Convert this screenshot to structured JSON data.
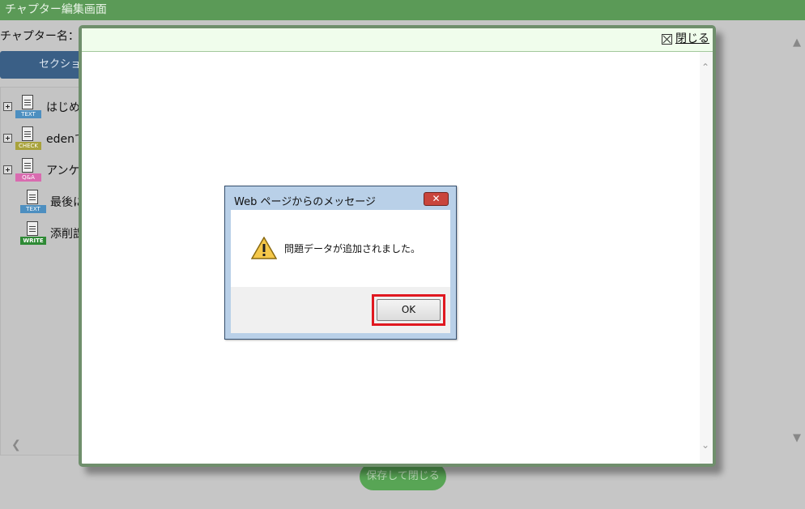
{
  "window": {
    "title": "チャプター編集画面"
  },
  "page": {
    "chapter_label": "チャプター名：",
    "section_button": "セクション",
    "save_button": "保存して閉じる"
  },
  "tree": {
    "items": [
      {
        "text": "はじめ",
        "icon": "text-doc-icon",
        "tag": "TEXT",
        "tag_color": "#4d8fc0",
        "expandable": true
      },
      {
        "text": "edenで",
        "icon": "check-doc-icon",
        "tag": "CHECK",
        "tag_color": "#a8a23c",
        "expandable": true
      },
      {
        "text": "アンケ",
        "icon": "qa-doc-icon",
        "tag": "Q&A",
        "tag_color": "#d96bb0",
        "expandable": true
      },
      {
        "text": "最後に",
        "icon": "text-doc-icon",
        "tag": "TEXT",
        "tag_color": "#4d8fc0",
        "expandable": false
      },
      {
        "text": "添削課",
        "icon": "write-doc-icon",
        "tag": "WRITE",
        "tag_color": "#2e8a35",
        "expandable": false
      }
    ]
  },
  "modal": {
    "close_label": "閉じる"
  },
  "alert": {
    "title": "Web ページからのメッセージ",
    "message": "問題データが追加されました。",
    "ok_label": "OK",
    "close_glyph": "✕",
    "icon": "warning-icon"
  },
  "colors": {
    "titlebar": "#5b9a57",
    "section_button": "#3a5f86",
    "save_button": "#58a555",
    "highlight": "#e01820"
  }
}
